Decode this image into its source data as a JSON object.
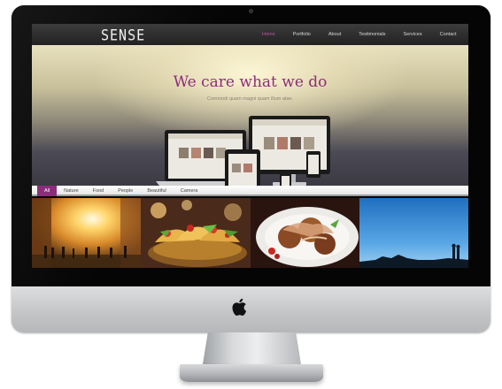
{
  "site": {
    "logo": "SENSE",
    "nav": [
      "Home",
      "Portfolio",
      "About",
      "Testimonials",
      "Services",
      "Contact"
    ],
    "active_nav_index": 0,
    "accent_color": "#8e2c7c"
  },
  "hero": {
    "title": "We care what we do",
    "subtitle": "Commodi quam magni quam illum atae."
  },
  "filters": {
    "items": [
      "All",
      "Nature",
      "Food",
      "People",
      "Beautiful",
      "Camera"
    ],
    "active_index": 0
  },
  "gallery": {
    "images": [
      "city-street-sunset-photo",
      "tacos-basket-photo",
      "takoyaki-plate-photo",
      "couple-silhouette-sky-photo"
    ]
  },
  "hardware": {
    "icon": "apple-icon"
  }
}
